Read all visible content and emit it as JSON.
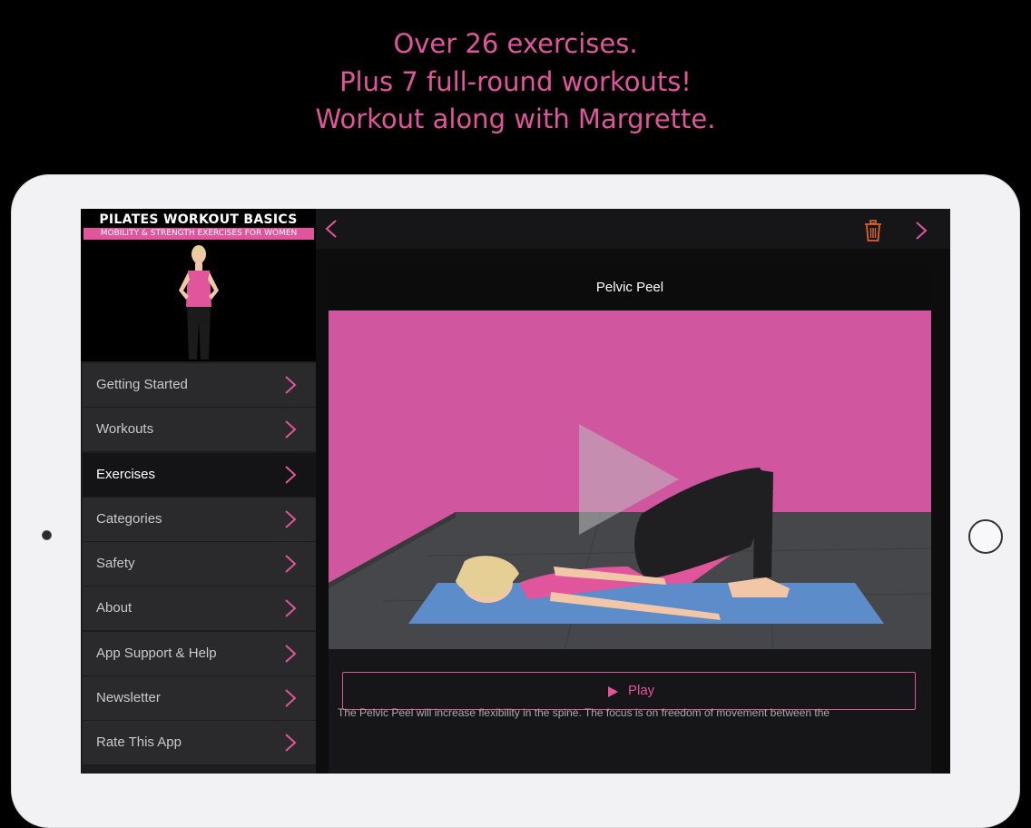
{
  "headline": {
    "line1": "Over 26 exercises.",
    "line2": "Plus 7 full-round workouts!",
    "line3": "Workout along with Margrette."
  },
  "app": {
    "banner_title": "PILATES WORKOUT BASICS",
    "banner_subtitle": "MOBILITY & STRENGTH EXERCISES FOR WOMEN"
  },
  "sidebar": {
    "items": [
      {
        "label": "Getting Started"
      },
      {
        "label": "Workouts"
      },
      {
        "label": "Exercises",
        "active": true
      },
      {
        "label": "Categories"
      },
      {
        "label": "Safety"
      },
      {
        "label": "About"
      },
      {
        "label": "App Support & Help"
      },
      {
        "label": "Newsletter"
      },
      {
        "label": "Rate This App"
      }
    ]
  },
  "navbar": {
    "back_icon": "chevron-left-icon",
    "trash_icon": "trash-icon",
    "next_icon": "chevron-right-icon"
  },
  "exercise": {
    "title": "Pelvic Peel",
    "play_label": "Play",
    "description": "The Pelvic Peel will increase flexibility in the spine. The focus is on freedom of movement between the"
  },
  "colors": {
    "accent": "#e0559c",
    "trash": "#d9642f",
    "background": "#000000"
  }
}
